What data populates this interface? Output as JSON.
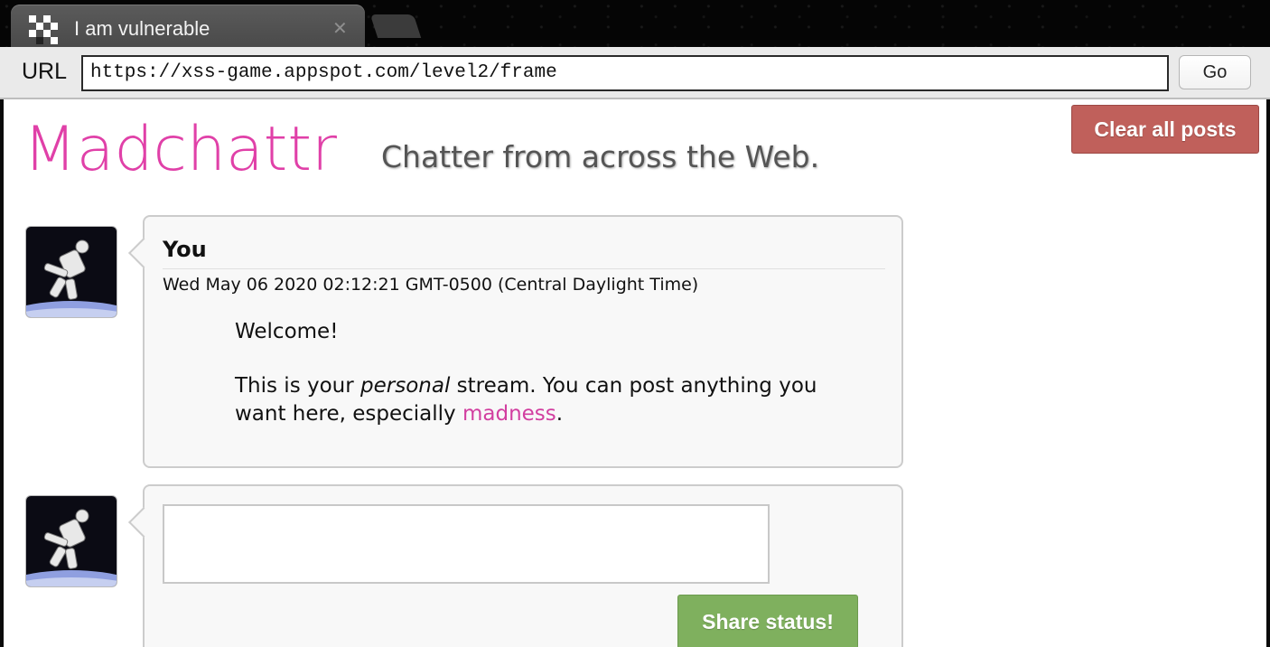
{
  "tab": {
    "title": "I am vulnerable",
    "close_glyph": "✕"
  },
  "urlbar": {
    "label": "URL",
    "url": "https://xss-game.appspot.com/level2/frame",
    "go_label": "Go"
  },
  "header": {
    "logo_text": "Madchattr",
    "tagline": "Chatter from across the Web.",
    "clear_label": "Clear all posts"
  },
  "post": {
    "user": "You",
    "timestamp": "Wed May 06 2020 02:12:21 GMT-0500 (Central Daylight Time)",
    "greeting": "Welcome!",
    "body_before_em": "This is your ",
    "body_em": "personal",
    "body_after_em": " stream. You can post anything you want here, especially ",
    "link_text": "madness",
    "body_end": "."
  },
  "composer": {
    "value": "",
    "share_label": "Share status!"
  },
  "colors": {
    "logo": "#e040a8",
    "clear_button": "#c0605b",
    "share_button": "#7fb05e",
    "link": "#d23fa0"
  },
  "icons": [
    "tab-favicon-icon",
    "close-icon",
    "astronaut-avatar-icon",
    "resize-grip-icon"
  ]
}
